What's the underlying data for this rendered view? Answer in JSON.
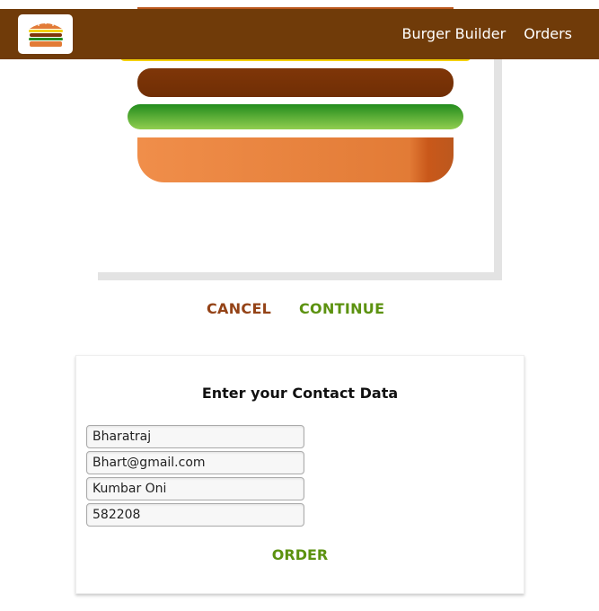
{
  "header": {
    "logo_icon": "burger-logo-icon",
    "nav": [
      {
        "label": "Burger Builder"
      },
      {
        "label": "Orders"
      }
    ],
    "background_color": "#703b09"
  },
  "burger_preview": {
    "ingredients": [
      "cheese",
      "meat",
      "salad",
      "bread-bottom"
    ]
  },
  "actions": {
    "cancel_label": "CANCEL",
    "continue_label": "CONTINUE",
    "cancel_color": "#944317",
    "continue_color": "#5c9210"
  },
  "contact_form": {
    "title": "Enter your Contact Data",
    "fields": {
      "name": {
        "value": "Bharatraj"
      },
      "email": {
        "value": "Bhart@gmail.com"
      },
      "street": {
        "value": "Kumbar Oni"
      },
      "postal": {
        "value": "582208"
      }
    },
    "order_label": "ORDER"
  }
}
